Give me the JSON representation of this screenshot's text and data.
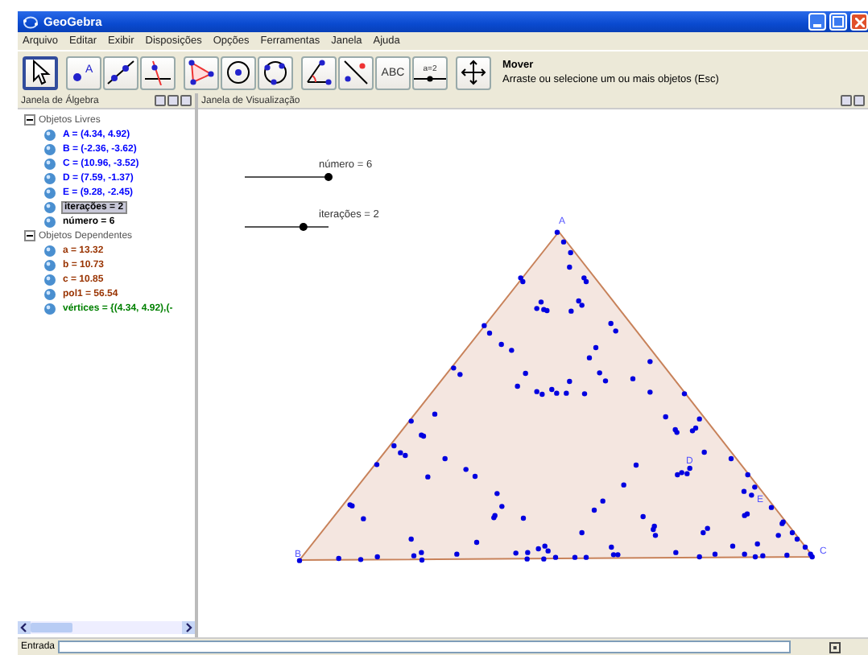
{
  "window": {
    "title": "GeoGebra"
  },
  "menu": [
    "Arquivo",
    "Editar",
    "Exibir",
    "Disposições",
    "Opções",
    "Ferramentas",
    "Janela",
    "Ajuda"
  ],
  "toolbar": [
    {
      "kind": "move",
      "selected": true
    },
    {
      "kind": "point",
      "label": "A",
      "selected": false
    },
    {
      "kind": "line",
      "selected": false
    },
    {
      "kind": "perpendicular",
      "selected": false
    },
    {
      "kind": "polygon",
      "selected": false
    },
    {
      "kind": "circle",
      "selected": false
    },
    {
      "kind": "conic",
      "selected": false
    },
    {
      "kind": "angle",
      "selected": false
    },
    {
      "kind": "reflect",
      "selected": false
    },
    {
      "kind": "text",
      "label": "ABC",
      "selected": false
    },
    {
      "kind": "slider",
      "label": "a=2",
      "selected": false
    },
    {
      "kind": "pan",
      "selected": false
    }
  ],
  "tool_help": {
    "name": "Mover",
    "description": "Arraste ou selecione um ou mais objetos (Esc)"
  },
  "algebra": {
    "title": "Janela de Álgebra",
    "tree": [
      {
        "label": "Objetos Livres",
        "expanded": true,
        "children": [
          {
            "label": "A = (4.34, 4.92)",
            "color": "#0000ff",
            "selected": false
          },
          {
            "label": "B = (-2.36, -3.62)",
            "color": "#0000ff",
            "selected": false
          },
          {
            "label": "C = (10.96, -3.52)",
            "color": "#0000ff",
            "selected": false
          },
          {
            "label": "D = (7.59, -1.37)",
            "color": "#0000ff",
            "selected": false
          },
          {
            "label": "E = (9.28, -2.45)",
            "color": "#0000ff",
            "selected": false
          },
          {
            "label": "iterações = 2",
            "color": "#000000",
            "selected": true
          },
          {
            "label": "número = 6",
            "color": "#000000",
            "selected": false
          }
        ]
      },
      {
        "label": "Objetos Dependentes",
        "expanded": true,
        "children": [
          {
            "label": "a = 13.32",
            "color": "#993300",
            "selected": false
          },
          {
            "label": "b = 10.73",
            "color": "#993300",
            "selected": false
          },
          {
            "label": "c = 10.85",
            "color": "#993300",
            "selected": false
          },
          {
            "label": "pol1 = 56.54",
            "color": "#993300",
            "selected": false
          },
          {
            "label": "vértices = {(4.34, 4.92),(-",
            "color": "#008000",
            "selected": false
          }
        ]
      }
    ]
  },
  "graphics": {
    "title": "Janela de Visualização",
    "sliders": [
      {
        "label": "número = 6",
        "level": 1.0
      },
      {
        "label": "iterações = 2",
        "level": 0.7
      }
    ],
    "vertex_labels": [
      {
        "text": "A"
      },
      {
        "text": "B"
      },
      {
        "text": "C"
      },
      {
        "text": "D"
      },
      {
        "text": "E"
      }
    ]
  },
  "input_bar": {
    "label": "Entrada"
  }
}
